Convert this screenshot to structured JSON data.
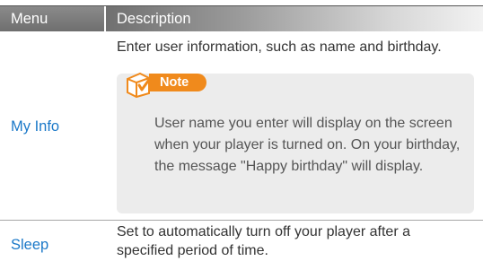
{
  "header": {
    "menu_label": "Menu",
    "description_label": "Description"
  },
  "rows": [
    {
      "menu": "My Info",
      "description": "Enter user information, such as name and birthday.",
      "note": {
        "label": "Note",
        "text": "User name you enter will display on the screen when your player is turned on. On your birthday, the message \"Happy birthday\" will display."
      }
    },
    {
      "menu": "Sleep",
      "description": "Set to automatically turn off your player after a specified period of time."
    }
  ],
  "colors": {
    "header_gray": "#7d7d7d",
    "menu_link_blue": "#1a78c8",
    "note_orange": "#f08a1c",
    "note_background": "#ececec"
  },
  "icons": {
    "note": "note-checkbox-icon"
  }
}
